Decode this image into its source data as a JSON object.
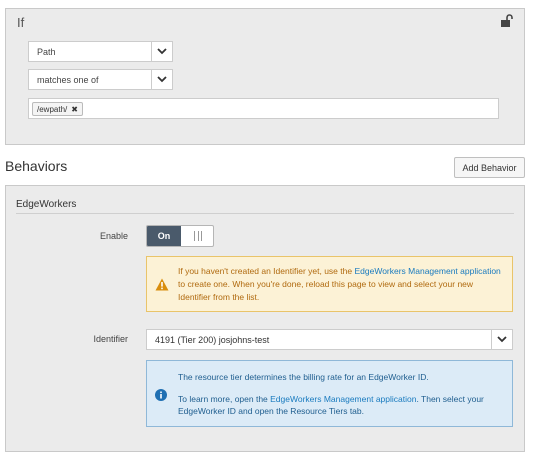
{
  "if_panel": {
    "title": "If",
    "condition_field": "Path",
    "condition_operator": "matches one of",
    "values": [
      "/ewpath/"
    ],
    "remove_tag_symbol": "✖"
  },
  "behaviors": {
    "title": "Behaviors",
    "add_button_label": "Add Behavior"
  },
  "edgeworkers": {
    "title": "EdgeWorkers",
    "enable_label": "Enable",
    "enable_state": "On",
    "warning": {
      "text_1": "If you haven't created an Identifier yet, use the ",
      "link_1": "EdgeWorkers Management application",
      "text_2": " to create one. When you're done, reload this page to view and select your new Identifier from the list."
    },
    "identifier_label": "Identifier",
    "identifier_value": "4191 (Tier 200) josjohns-test",
    "info": {
      "line_1": "The resource tier determines the billing rate for an EdgeWorker ID.",
      "text_2a": "To learn more, open the ",
      "link_2": "EdgeWorkers Management application",
      "text_2b": ". Then select your EdgeWorker ID and open the Resource Tiers tab."
    }
  },
  "colors": {
    "toggle_on": "#4a5a6b",
    "warning_bg": "#fcf2d6",
    "warning_text": "#b06a0f",
    "info_bg": "#dcebf7",
    "info_text": "#1f5e8f",
    "link": "#1a7bbf"
  }
}
